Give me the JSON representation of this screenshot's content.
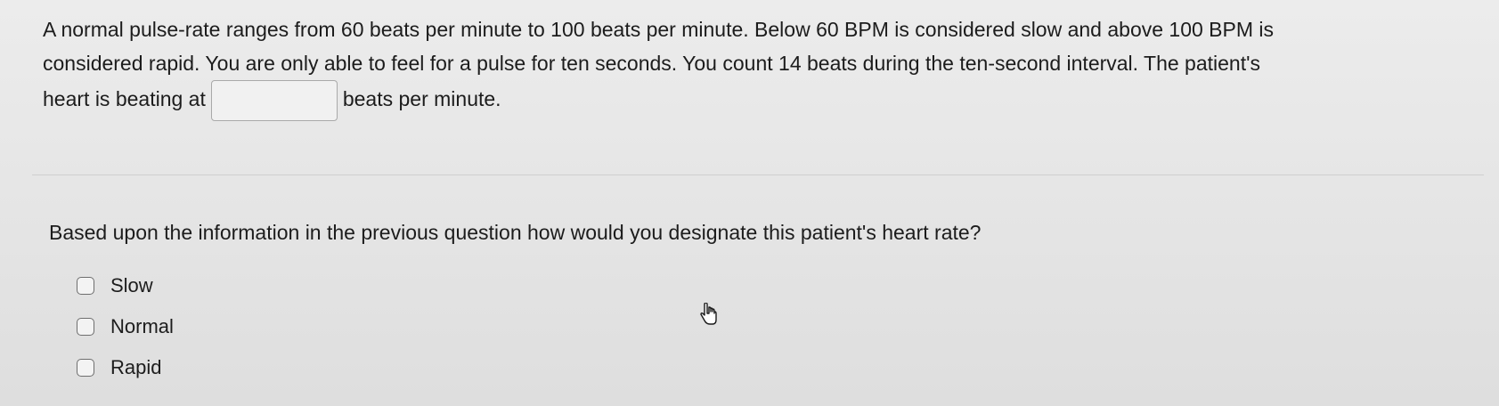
{
  "question1": {
    "line1": "A normal pulse-rate ranges from 60 beats per minute to 100 beats per minute.  Below 60 BPM is considered slow and above 100 BPM is",
    "line2": "considered rapid.  You are only able to feel for a pulse for ten seconds. You count 14 beats during the ten-second interval.  The patient's",
    "line3_before": "heart is beating at",
    "answer_value": "",
    "line3_after": "beats per minute."
  },
  "question2": {
    "prompt": "Based upon the information in the previous question how would you designate this patient's heart rate?",
    "options": [
      {
        "label": "Slow",
        "checked": false
      },
      {
        "label": "Normal",
        "checked": false
      },
      {
        "label": "Rapid",
        "checked": false
      }
    ]
  },
  "cursor": {
    "icon": "hand-pointer-icon"
  }
}
